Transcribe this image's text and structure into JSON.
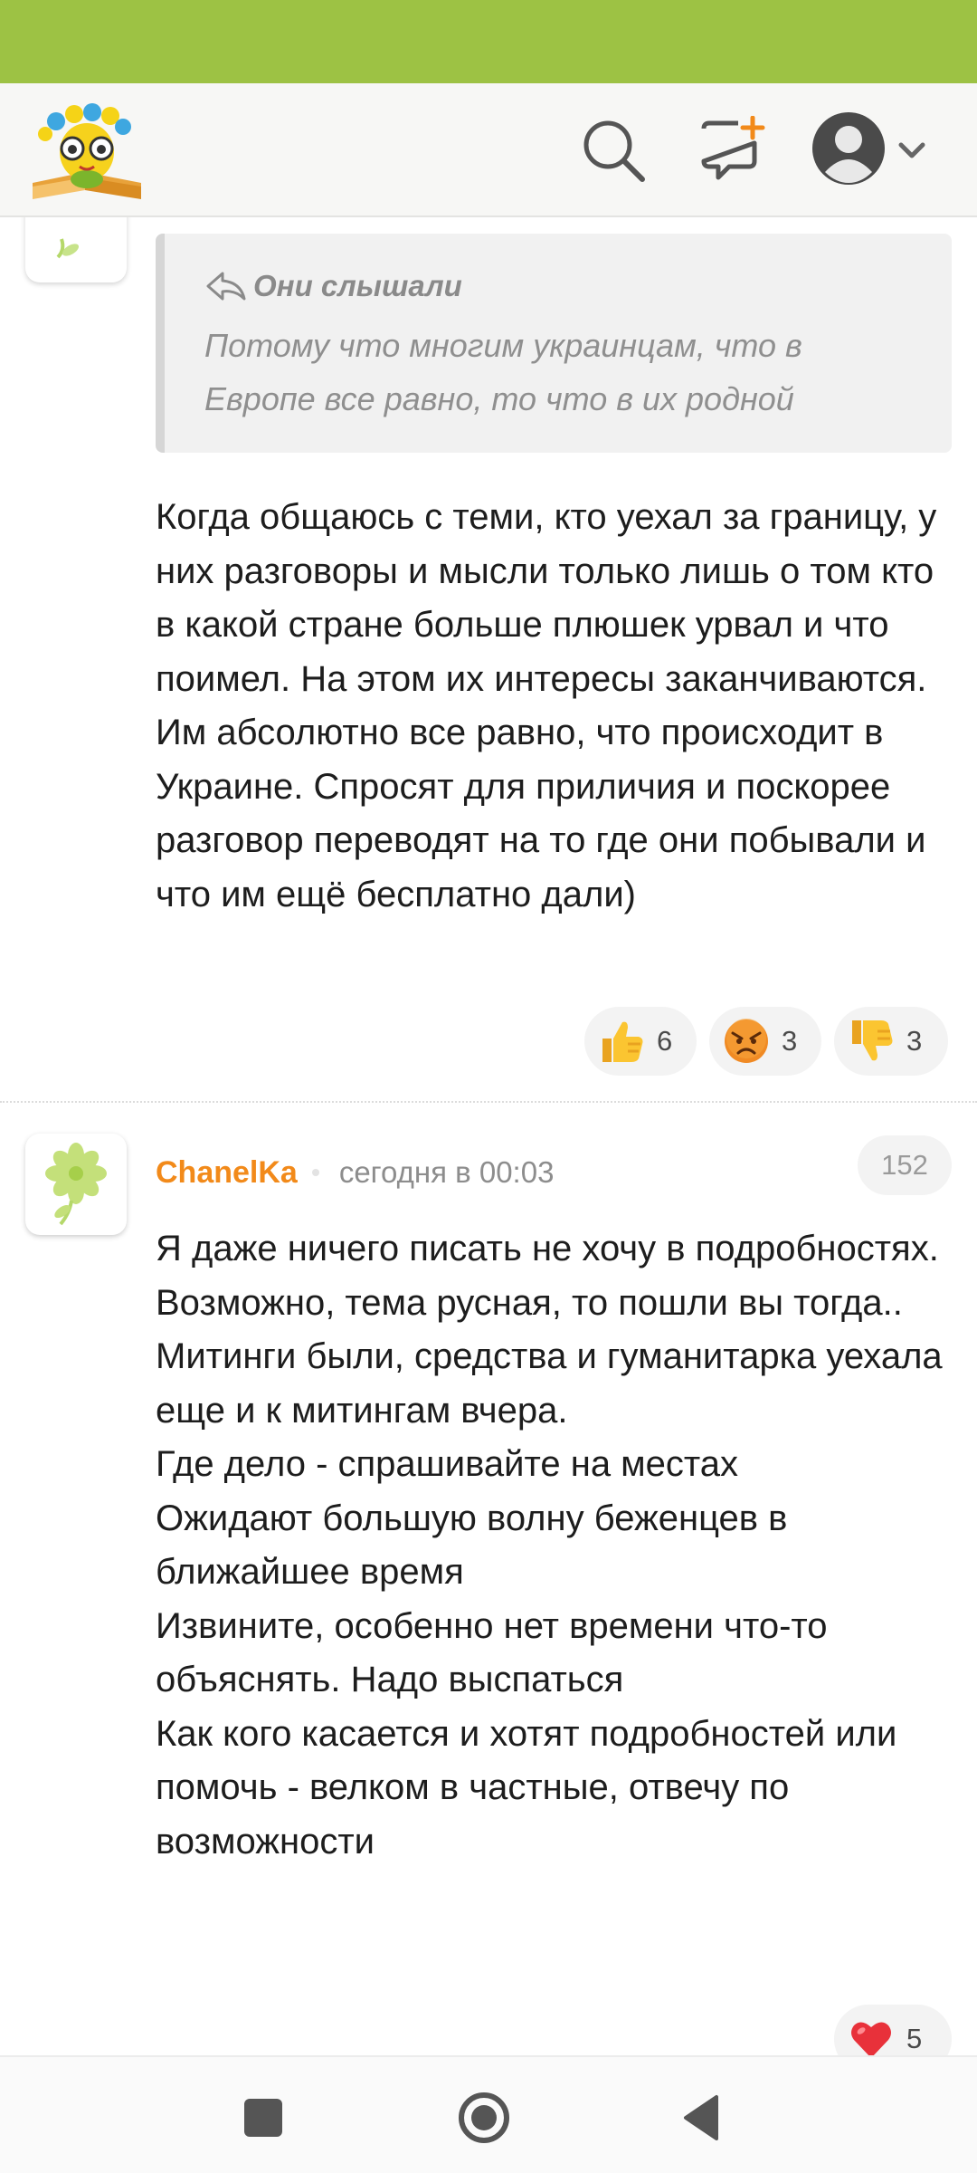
{
  "app": {
    "accent_color": "#9dc244",
    "author_color": "#f28a1a",
    "icons": [
      "logo-icon",
      "search-icon",
      "compose-icon",
      "avatar-icon",
      "chevron-down-icon",
      "reply-arrow-icon",
      "flower-icon",
      "thumbs-up-icon",
      "angry-face-icon",
      "thumbs-down-icon",
      "heart-icon",
      "nav-recent-icon",
      "nav-home-icon",
      "nav-back-icon"
    ]
  },
  "comment1": {
    "quote": {
      "author": "Они слышали",
      "text": "Потому что многим украинцам, что в Европе все равно, то что в их родной стране. Им в…"
    },
    "text": "Когда общаюсь с теми, кто уехал за границу, у них разговоры и мысли только лишь о том кто в какой стране больше плюшек урвал и что поимел. На этом их интересы заканчиваются. Им абсолютно все равно, что происходит в Украине. Спросят для приличия и поскорее разговор переводят на то где они побывали и что им ещё бесплатно дали)",
    "reactions": {
      "like": "6",
      "angry": "3",
      "dislike": "3"
    }
  },
  "comment2": {
    "author": "ChanelKa",
    "timestamp": "сегодня в 00:03",
    "rating": "152",
    "text_lines": [
      "Я даже ничего писать не хочу в подробностях.",
      "Возможно, тема русная, то пошли вы тогда..",
      "Митинги были, средства и гуманитарка уехала еще и к митингам вчера.",
      "Где дело - спрашивайте на местах",
      "Ожидают большую волну беженцев в ближайшее время",
      "Извините, особенно нет времени что-то объяснять. Надо выспаться",
      "Как кого касается и хотят подробностей или помочь - велком в частные, отвечу по возможности"
    ],
    "reactions": {
      "heart": "5"
    }
  }
}
